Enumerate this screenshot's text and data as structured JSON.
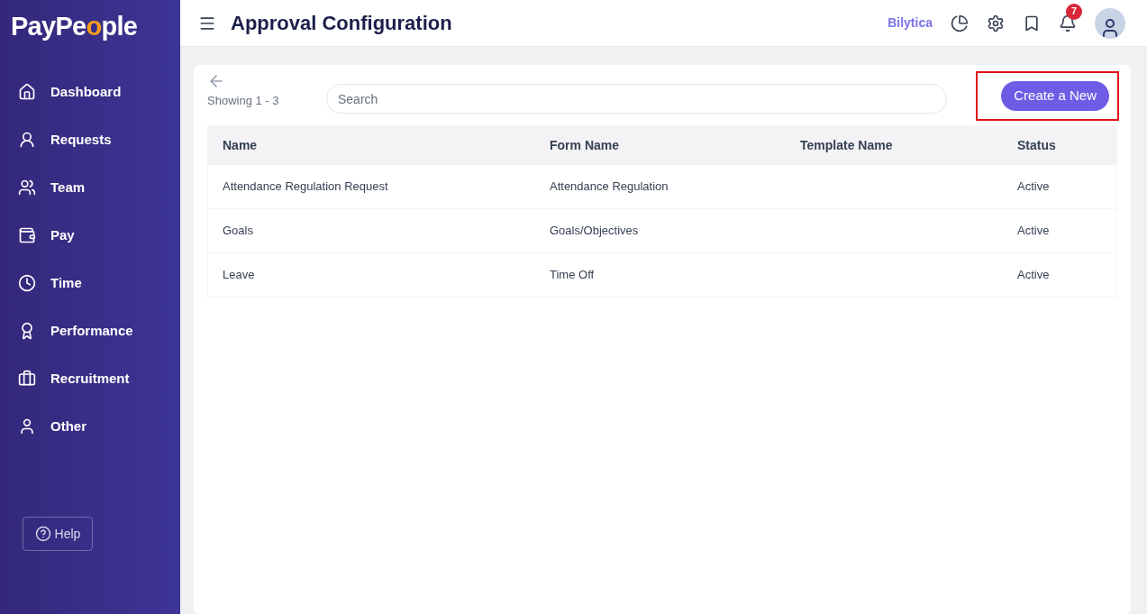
{
  "sidebar": {
    "logo": [
      {
        "text": "PayPe",
        "accent": false
      },
      {
        "text": "o",
        "accent": true
      },
      {
        "text": "ple",
        "accent": false
      }
    ],
    "items": [
      {
        "label": "Dashboard",
        "kind": "home",
        "selected": false
      },
      {
        "label": "Requests",
        "kind": "requests",
        "selected": false
      },
      {
        "label": "Team",
        "kind": "team",
        "selected": false
      },
      {
        "label": "Pay",
        "kind": "wallet",
        "selected": false
      },
      {
        "label": "Time",
        "kind": "clock",
        "selected": false
      },
      {
        "label": "Performance",
        "kind": "award",
        "selected": false
      },
      {
        "label": "Recruitment",
        "kind": "briefcase",
        "selected": false
      },
      {
        "label": "Other",
        "kind": "user",
        "selected": false
      }
    ],
    "help": "Help"
  },
  "header": {
    "title": "Approval Configuration",
    "brand": "Bilytica",
    "notification_count": "7"
  },
  "toolbar": {
    "showing": "Showing 1 - 3",
    "search": {
      "placeholder": "Search"
    },
    "create_button": "Create a New",
    "create_highlighted": true
  },
  "table": {
    "columns": [
      "Name",
      "Form Name",
      "Template Name",
      "Status"
    ],
    "rows": [
      [
        "Attendance Regulation Request",
        "Attendance Regulation",
        "",
        "Active"
      ],
      [
        "Goals",
        "Goals/Objectives",
        "",
        "Active"
      ],
      [
        "Leave",
        "Time Off",
        "",
        "Active"
      ]
    ]
  }
}
